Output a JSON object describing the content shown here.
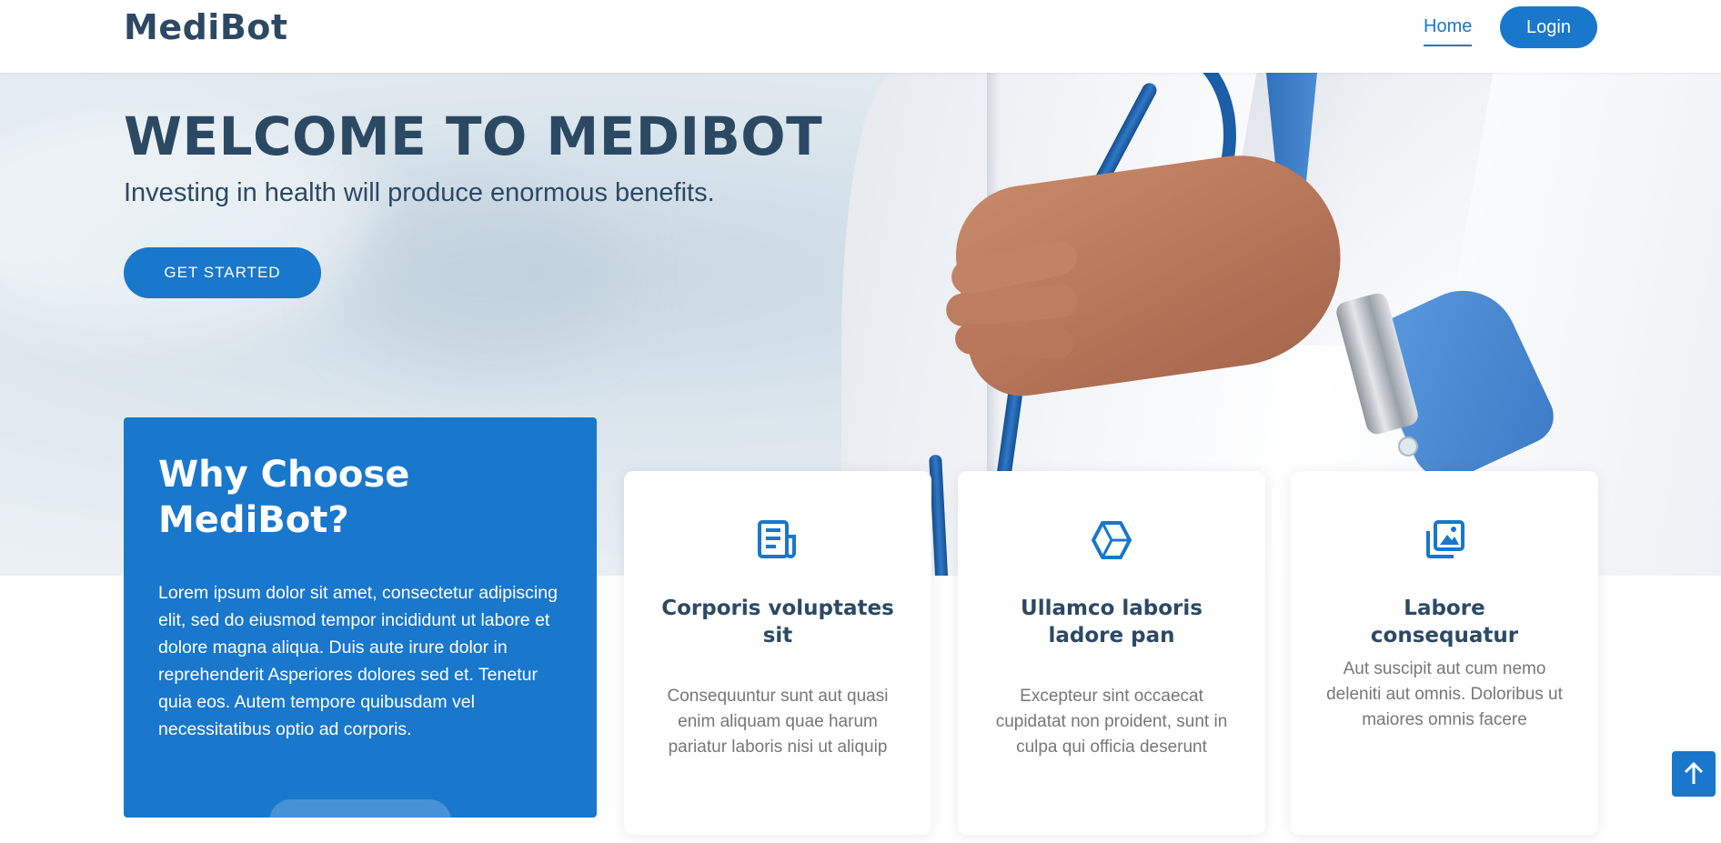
{
  "header": {
    "logo": "MediBot",
    "nav": {
      "home": "Home"
    },
    "login": "Login"
  },
  "hero": {
    "title": "WELCOME TO MEDIBOT",
    "subtitle": "Investing in health will produce enormous benefits.",
    "cta": "GET STARTED"
  },
  "why": {
    "title": "Why Choose MediBot?",
    "body": "Lorem ipsum dolor sit amet, consectetur adipiscing elit, sed do eiusmod tempor incididunt ut labore et dolore magna aliqua. Duis aute irure dolor in reprehenderit Asperiores dolores sed et. Tenetur quia eos. Autem tempore quibusdam vel necessitatibus optio ad corporis."
  },
  "cards": [
    {
      "icon": "receipt-icon",
      "title": "Corporis voluptates sit",
      "text": "Consequuntur sunt aut quasi enim aliquam quae harum pariatur laboris nisi ut aliquip"
    },
    {
      "icon": "cube-icon",
      "title": "Ullamco laboris ladore pan",
      "text": "Excepteur sint occaecat cupidatat non proident, sunt in culpa qui officia deserunt"
    },
    {
      "icon": "images-icon",
      "title": "Labore consequatur",
      "text": "Aut suscipit aut cum nemo deleniti aut omnis. Doloribus ut maiores omnis facere"
    }
  ],
  "colors": {
    "accent": "#1977cc",
    "heading": "#2c4964",
    "muted": "#777777"
  },
  "back_to_top_icon": "arrow-up-icon"
}
